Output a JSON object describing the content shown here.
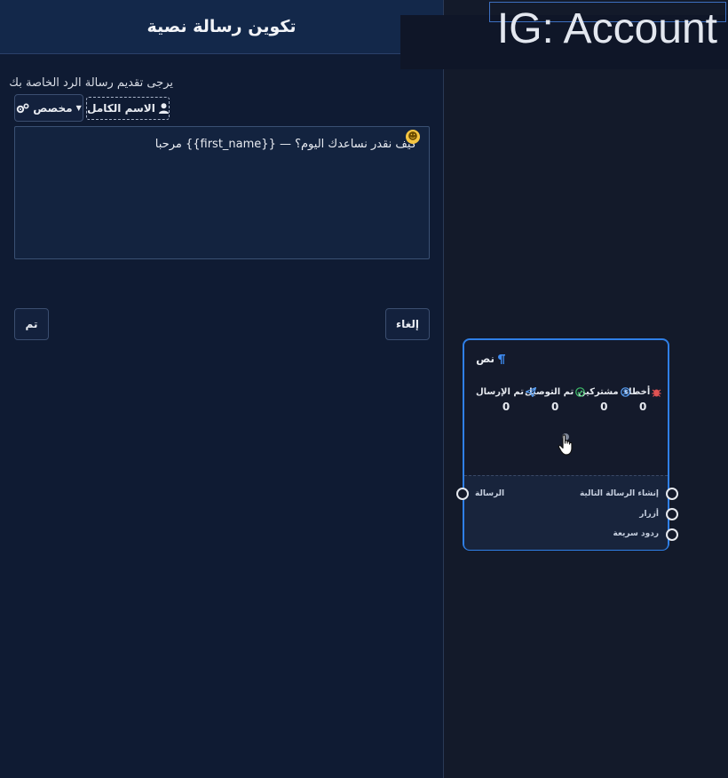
{
  "panel": {
    "title": "تكوين رسالة نصية",
    "instruction": "يرجى تقديم رسالة الرد الخاصة بك",
    "custom_button": "مخصص",
    "fullname_button": "الاسم الكامل",
    "message_value": "كيف نقدر نساعدك اليوم؟ — {{first_name}} مرحبا",
    "done_button": "تم",
    "cancel_button": "إلغاء"
  },
  "canvas": {
    "title": "IG: Account"
  },
  "node": {
    "title": "نص",
    "stats": [
      {
        "label": "تم الإرسال",
        "value": "0",
        "icon": "paper-plane-icon"
      },
      {
        "label": "تم التوصيل",
        "value": "0",
        "icon": "check-circle-icon"
      },
      {
        "label": "مشتركين",
        "value": "0",
        "icon": "user-circle-icon"
      },
      {
        "label": "أخطاء",
        "value": "0",
        "icon": "bug-icon"
      }
    ],
    "ports": {
      "input": "الرسالة",
      "next_message": "إنشاء الرسالة التالية",
      "buttons": "أزرار",
      "quick_replies": "ردود سريعة"
    }
  },
  "colors": {
    "accent": "#2f7fe6",
    "error": "#e05252",
    "success": "#3fbf6a"
  }
}
